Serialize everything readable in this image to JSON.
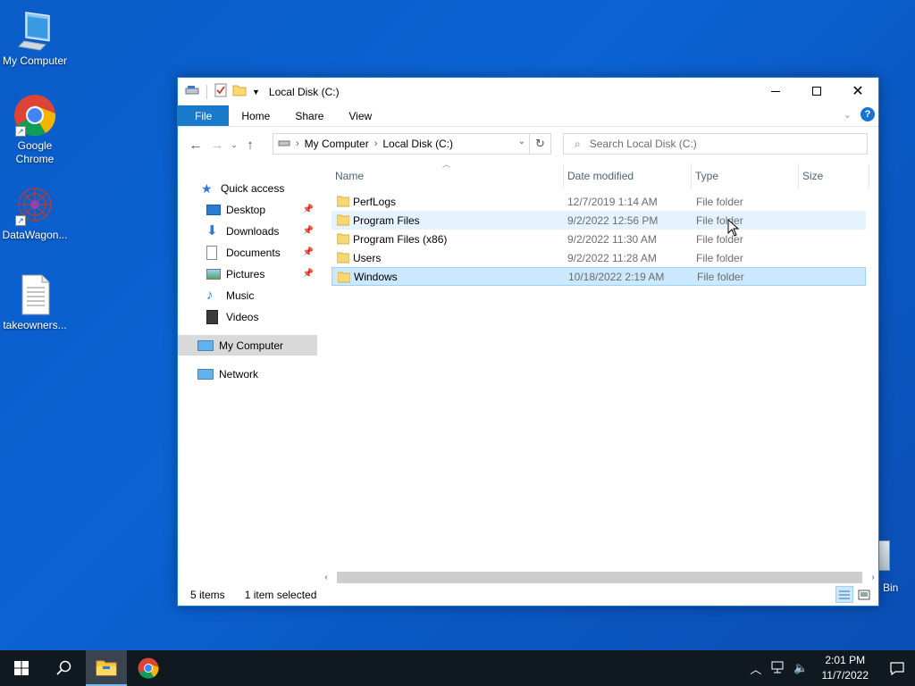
{
  "desktop": {
    "icons": [
      {
        "label": "My Computer"
      },
      {
        "label": "Google Chrome"
      },
      {
        "label": "DataWagon..."
      },
      {
        "label": "takeowners..."
      }
    ],
    "recycle_label": "Bin"
  },
  "window": {
    "title": "Local Disk (C:)",
    "ribbon_tabs": [
      "File",
      "Home",
      "Share",
      "View"
    ],
    "help": "?",
    "address": {
      "crumbs": [
        "My Computer",
        "Local Disk (C:)"
      ]
    },
    "search": {
      "placeholder": "Search Local Disk (C:)"
    },
    "navpane": {
      "quick_access": "Quick access",
      "items": [
        {
          "label": "Desktop",
          "pinned": true
        },
        {
          "label": "Downloads",
          "pinned": true
        },
        {
          "label": "Documents",
          "pinned": true
        },
        {
          "label": "Pictures",
          "pinned": true
        },
        {
          "label": "Music",
          "pinned": false
        },
        {
          "label": "Videos",
          "pinned": false
        }
      ],
      "my_computer": "My Computer",
      "network": "Network"
    },
    "columns": {
      "name": "Name",
      "date": "Date modified",
      "type": "Type",
      "size": "Size"
    },
    "files": [
      {
        "name": "PerfLogs",
        "date": "12/7/2019 1:14 AM",
        "type": "File folder"
      },
      {
        "name": "Program Files",
        "date": "9/2/2022 12:56 PM",
        "type": "File folder"
      },
      {
        "name": "Program Files (x86)",
        "date": "9/2/2022 11:30 AM",
        "type": "File folder"
      },
      {
        "name": "Users",
        "date": "9/2/2022 11:28 AM",
        "type": "File folder"
      },
      {
        "name": "Windows",
        "date": "10/18/2022 2:19 AM",
        "type": "File folder"
      }
    ],
    "status": {
      "items": "5 items",
      "selected": "1 item selected"
    }
  },
  "taskbar": {
    "time": "2:01 PM",
    "date": "11/7/2022"
  },
  "colors": {
    "accent": "#1979ca",
    "selection": "#cce8ff",
    "desktop": "#0b63d4",
    "taskbar": "#101820"
  }
}
